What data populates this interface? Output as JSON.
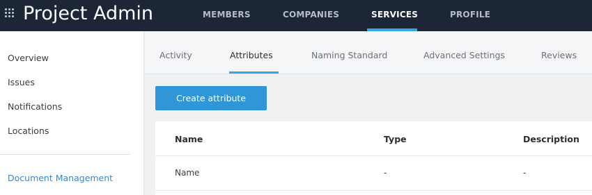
{
  "header": {
    "app_title": "Project Admin",
    "menu_icon": "grid-menu-icon",
    "nav": [
      {
        "label": "MEMBERS",
        "active": false
      },
      {
        "label": "COMPANIES",
        "active": false
      },
      {
        "label": "SERVICES",
        "active": true
      },
      {
        "label": "PROFILE",
        "active": false
      }
    ],
    "accent_color": "#36a6e0"
  },
  "sidebar": {
    "items": [
      {
        "label": "Overview"
      },
      {
        "label": "Issues"
      },
      {
        "label": "Notifications"
      },
      {
        "label": "Locations"
      }
    ],
    "section_link": "Document Management"
  },
  "tabs": [
    {
      "label": "Activity",
      "active": false
    },
    {
      "label": "Attributes",
      "active": true
    },
    {
      "label": "Naming Standard",
      "active": false
    },
    {
      "label": "Advanced Settings",
      "active": false
    },
    {
      "label": "Reviews",
      "active": false
    }
  ],
  "toolbar": {
    "create_label": "Create attribute"
  },
  "table": {
    "columns": [
      "Name",
      "Type",
      "Description"
    ],
    "rows": [
      [
        "Name",
        "-",
        "-"
      ]
    ]
  }
}
